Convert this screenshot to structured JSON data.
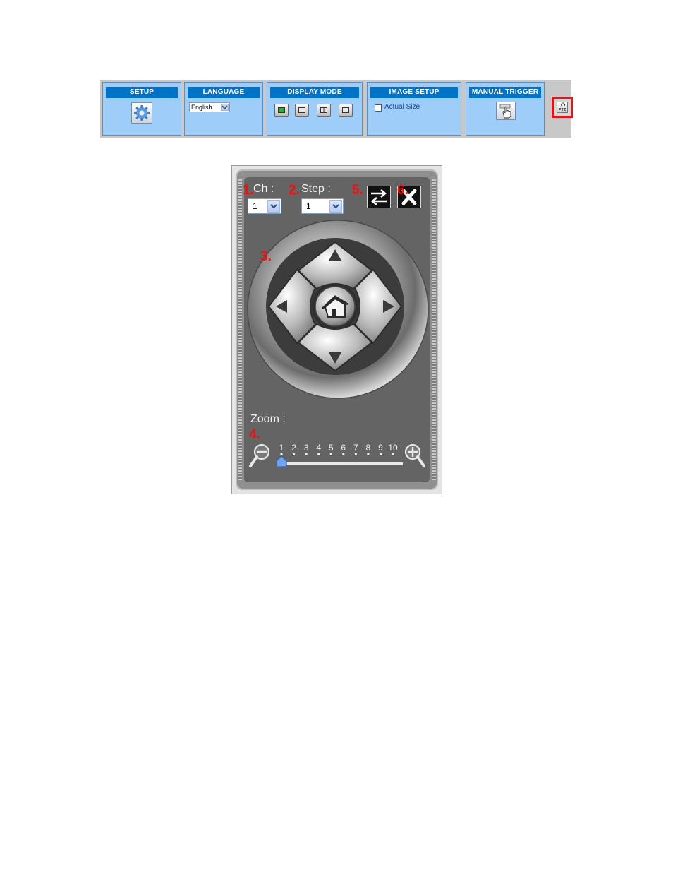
{
  "toolbar": {
    "setup": {
      "title": "SETUP"
    },
    "language": {
      "title": "LANGUAGE",
      "selected": "English"
    },
    "display_mode": {
      "title": "DISPLAY MODE"
    },
    "image_setup": {
      "title": "IMAGE SETUP",
      "checkbox_label": "Actual Size",
      "checked": false
    },
    "manual_trigger": {
      "title": "MANUAL TRIGGER"
    },
    "ptz": {
      "label": "PTZ"
    }
  },
  "ptz_panel": {
    "channel": {
      "marker": "1.",
      "label": "Ch :",
      "value": "1"
    },
    "step": {
      "marker": "2.",
      "label": "Step :",
      "value": "1"
    },
    "dpad_marker": "3.",
    "zoom": {
      "label": "Zoom :",
      "marker": "4.",
      "ticks": [
        "1",
        "2",
        "3",
        "4",
        "5",
        "6",
        "7",
        "8",
        "9",
        "10"
      ],
      "level": 1
    },
    "swap_marker": "5.",
    "close_marker": "6."
  },
  "colors": {
    "header_blue": "#0073c6",
    "panel_blue": "#9fcdf9",
    "highlight_red": "#e0161b",
    "marker_red": "#e8140f"
  }
}
